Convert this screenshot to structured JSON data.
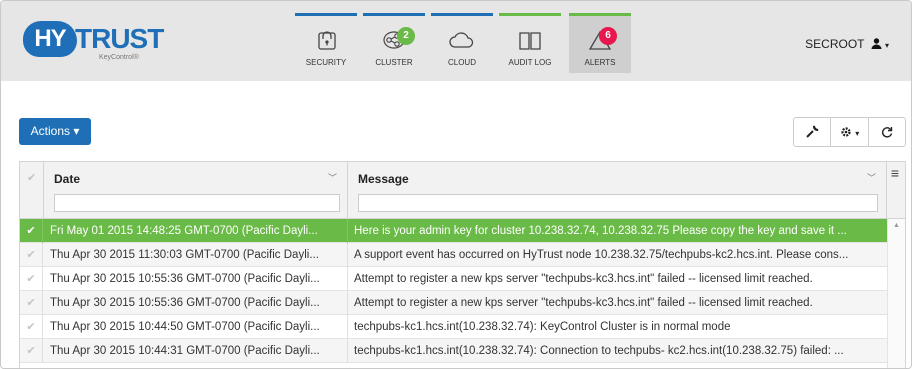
{
  "header": {
    "logo_prefix": "HY",
    "logo_main": "TRUST",
    "logo_sub": "KeyControl®",
    "nav": [
      {
        "label": "SECURITY",
        "icon": "lock-icon",
        "bar_color": "#1f6fb6"
      },
      {
        "label": "CLUSTER",
        "icon": "cluster-icon",
        "bar_color": "#1f6fb6",
        "badge": "2",
        "badge_color": "#6aba47"
      },
      {
        "label": "CLOUD",
        "icon": "cloud-icon",
        "bar_color": "#1f6fb6"
      },
      {
        "label": "AUDIT LOG",
        "icon": "book-icon",
        "bar_color": "#6aba47"
      },
      {
        "label": "ALERTS",
        "icon": "alert-triangle-icon",
        "bar_color": "#6aba47",
        "badge": "6",
        "badge_color": "#e8174e",
        "active": true
      }
    ],
    "user": "SECROOT"
  },
  "toolbar": {
    "actions_label": "Actions ▾",
    "tools": [
      "wrench-icon",
      "gear-dropdown-icon",
      "refresh-icon"
    ]
  },
  "grid": {
    "columns": [
      {
        "title": "Date"
      },
      {
        "title": "Message"
      }
    ],
    "rows": [
      {
        "date": "Fri May 01 2015 14:48:25 GMT-0700 (Pacific Dayli...",
        "message": "Here is your admin key for cluster 10.238.32.74, 10.238.32.75 Please copy the key and save it ...",
        "selected": true
      },
      {
        "date": "Thu Apr 30 2015 11:30:03 GMT-0700 (Pacific Dayli...",
        "message": "A support event has occurred on HyTrust node 10.238.32.75/techpubs-kc2.hcs.int. Please cons..."
      },
      {
        "date": "Thu Apr 30 2015 10:55:36 GMT-0700 (Pacific Dayli...",
        "message": "Attempt to register a new kps server \"techpubs-kc3.hcs.int\" failed -- licensed limit reached."
      },
      {
        "date": "Thu Apr 30 2015 10:55:36 GMT-0700 (Pacific Dayli...",
        "message": "Attempt to register a new kps server \"techpubs-kc3.hcs.int\" failed -- licensed limit reached."
      },
      {
        "date": "Thu Apr 30 2015 10:44:50 GMT-0700 (Pacific Dayli...",
        "message": "techpubs-kc1.hcs.int(10.238.32.74): KeyControl Cluster is in normal mode"
      },
      {
        "date": "Thu Apr 30 2015 10:44:31 GMT-0700 (Pacific Dayli...",
        "message": "techpubs-kc1.hcs.int(10.238.32.74): Connection to techpubs- kc2.hcs.int(10.238.32.75) failed: ..."
      }
    ]
  },
  "colors": {
    "brand_blue": "#1f6fb6",
    "select_green": "#6aba47",
    "alert_red": "#e8174e"
  }
}
